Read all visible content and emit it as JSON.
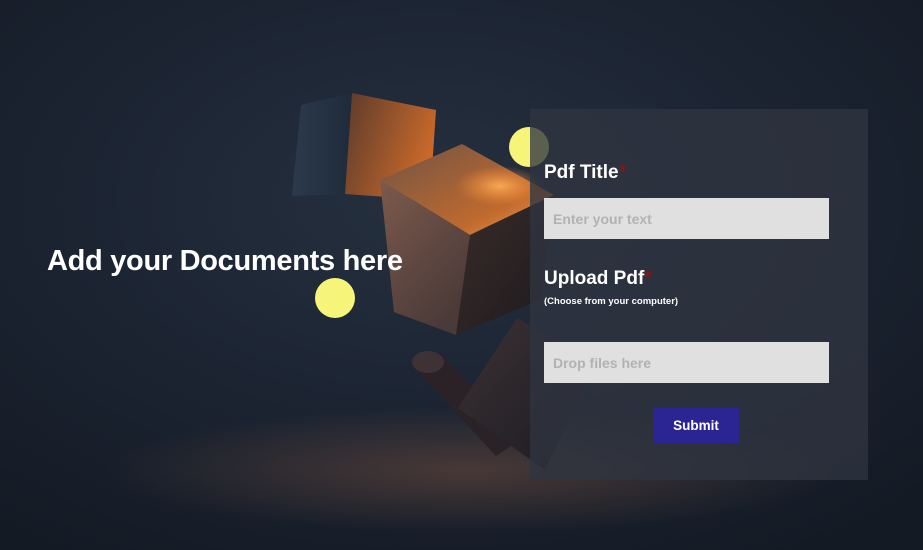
{
  "hero": {
    "headline": "Add your Documents here"
  },
  "form": {
    "title_label": "Pdf Title",
    "required_marker": "*",
    "title_placeholder": "Enter your text",
    "upload_label": "Upload Pdf",
    "upload_hint": "(Choose from your computer)",
    "dropzone_text": "Drop files here",
    "submit_label": "Submit"
  },
  "colors": {
    "accent_button": "#2a2593",
    "required_marker": "#8b1414",
    "decor_dots": "#f6f57a",
    "input_background": "#e0e0e0"
  }
}
